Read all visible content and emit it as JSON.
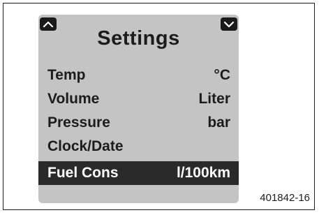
{
  "screen": {
    "title": "Settings",
    "nav": {
      "up_icon": "chevron-up-icon",
      "down_icon": "chevron-down-icon"
    },
    "items": [
      {
        "label": "Temp",
        "value": "°C",
        "selected": false
      },
      {
        "label": "Volume",
        "value": "Liter",
        "selected": false
      },
      {
        "label": "Pressure",
        "value": "bar",
        "selected": false
      },
      {
        "label": "Clock/Date",
        "value": "",
        "selected": false
      },
      {
        "label": "Fuel Cons",
        "value": "l/100km",
        "selected": true
      }
    ]
  },
  "figure_ref": "401842-16",
  "colors": {
    "screen_bg": "#c4c4c4",
    "text": "#1c1c1c",
    "selected_bg": "#2a2a2a",
    "selected_text": "#ffffff"
  }
}
